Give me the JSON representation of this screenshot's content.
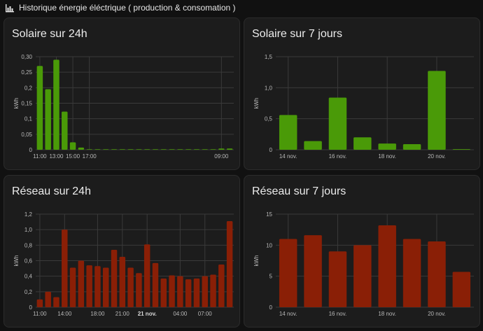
{
  "header": {
    "icon": "chart-bar-icon",
    "title": "Historique énergie éléctrique ( production & consomation )"
  },
  "colors": {
    "solar": "#4a9a08",
    "grid": "#8a1f06",
    "background": "#111111",
    "card": "#1c1c1c"
  },
  "charts": [
    {
      "title": "Solaire sur 24h",
      "chart_data": {
        "type": "bar",
        "ylabel": "kWh",
        "ylim": [
          0,
          0.3
        ],
        "yticks": [
          "0",
          "0,05",
          "0,1",
          "0,15",
          "0,2",
          "0,25",
          "0,30"
        ],
        "xtick_labels": [
          "11:00",
          "13:00",
          "15:00",
          "17:00",
          "09:00"
        ],
        "xtick_bold": [
          false,
          false,
          false,
          false,
          false
        ],
        "xtick_positions": [
          0.5,
          2.5,
          4.5,
          6.5,
          22.5
        ],
        "slots": 24,
        "values": [
          0.27,
          0.195,
          0.29,
          0.123,
          0.024,
          0.007,
          0.001,
          0.001,
          0.001,
          0.001,
          0.001,
          0.001,
          0.001,
          0.001,
          0.001,
          0.001,
          0.001,
          0.001,
          0.001,
          0.001,
          0.001,
          0.001,
          0.004,
          0.004
        ],
        "color": "#4a9a08"
      }
    },
    {
      "title": "Solaire sur 7 jours",
      "chart_data": {
        "type": "bar",
        "ylabel": "kWh",
        "ylim": [
          0,
          1.5
        ],
        "yticks": [
          "0",
          "0,5",
          "1,0",
          "1,5"
        ],
        "xtick_labels": [
          "14 nov.",
          "16 nov.",
          "18 nov.",
          "20 nov."
        ],
        "xtick_bold": [
          false,
          false,
          false,
          false
        ],
        "xtick_positions": [
          0.5,
          2.5,
          4.5,
          6.5
        ],
        "slots": 8,
        "values": [
          0.56,
          0.14,
          0.84,
          0.2,
          0.1,
          0.09,
          1.27,
          0.01
        ],
        "color": "#4a9a08"
      }
    },
    {
      "title": "Réseau sur 24h",
      "chart_data": {
        "type": "bar",
        "ylabel": "kWh",
        "ylim": [
          0,
          1.2
        ],
        "yticks": [
          "0",
          "0,2",
          "0,4",
          "0,6",
          "0,8",
          "1,0",
          "1,2"
        ],
        "xtick_labels": [
          "11:00",
          "14:00",
          "18:00",
          "21:00",
          "21 nov.",
          "04:00",
          "07:00"
        ],
        "xtick_bold": [
          false,
          false,
          false,
          false,
          true,
          false,
          false
        ],
        "xtick_positions": [
          0.5,
          3.5,
          7.5,
          10.5,
          13.5,
          17.5,
          20.5
        ],
        "slots": 24,
        "values": [
          0.1,
          0.2,
          0.13,
          1.0,
          0.51,
          0.6,
          0.54,
          0.53,
          0.51,
          0.74,
          0.65,
          0.51,
          0.44,
          0.81,
          0.57,
          0.37,
          0.41,
          0.4,
          0.36,
          0.37,
          0.4,
          0.42,
          0.55,
          1.11
        ],
        "color": "#8a1f06"
      }
    },
    {
      "title": "Réseau sur 7 jours",
      "chart_data": {
        "type": "bar",
        "ylabel": "kWh",
        "ylim": [
          0,
          15
        ],
        "yticks": [
          "0",
          "5",
          "10",
          "15"
        ],
        "xtick_labels": [
          "14 nov.",
          "16 nov.",
          "18 nov.",
          "20 nov."
        ],
        "xtick_bold": [
          false,
          false,
          false,
          false
        ],
        "xtick_positions": [
          0.5,
          2.5,
          4.5,
          6.5
        ],
        "slots": 8,
        "values": [
          11.0,
          11.6,
          9.0,
          10.0,
          13.2,
          11.0,
          10.6,
          5.7
        ],
        "color": "#8a1f06"
      }
    }
  ]
}
